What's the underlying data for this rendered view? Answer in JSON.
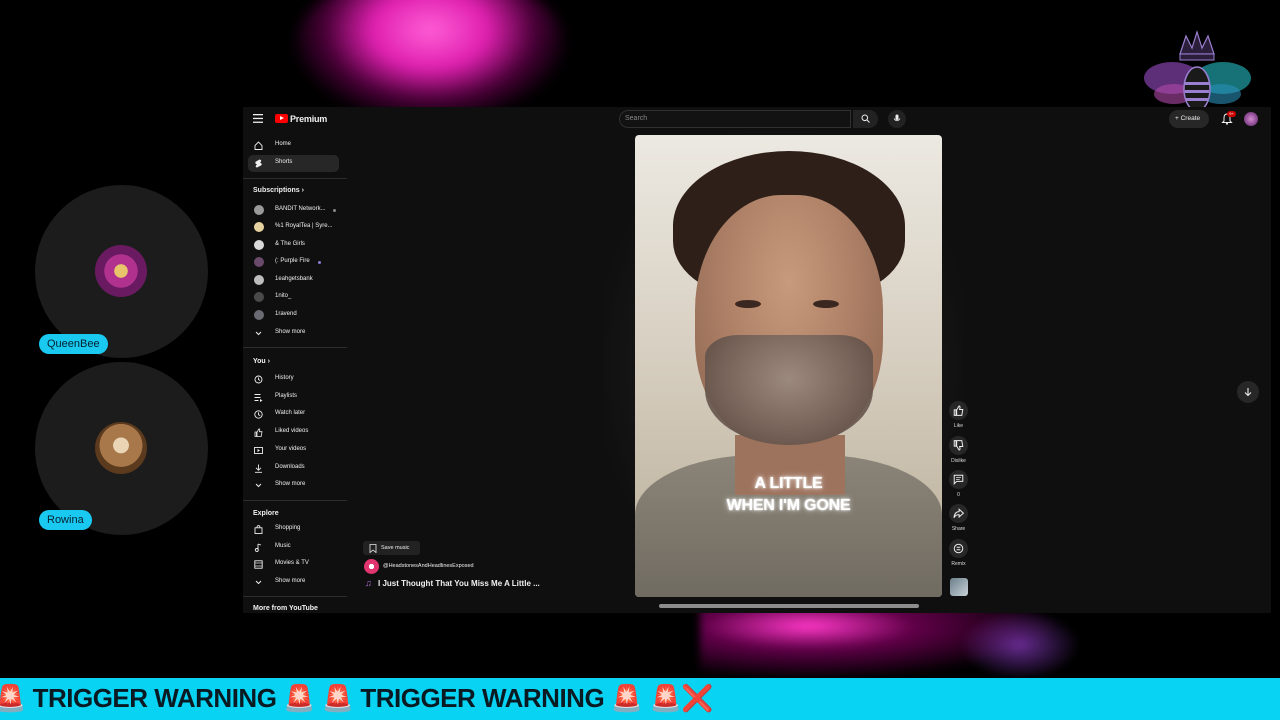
{
  "participants": [
    {
      "name": "QueenBee"
    },
    {
      "name": "Rowina"
    }
  ],
  "youtube": {
    "brand": "Premium",
    "search_placeholder": "Search",
    "create_label": "+ Create",
    "notification_count": "9+",
    "sidebar": {
      "main_items": [
        {
          "label": "Home",
          "icon": "home-icon"
        },
        {
          "label": "Shorts",
          "icon": "shorts-icon"
        }
      ],
      "subscriptions_heading": "Subscriptions",
      "subscriptions": [
        {
          "label": "BANDIT Network..."
        },
        {
          "label": "%1 RoyalTea | Syre..."
        },
        {
          "label": "& The Girls"
        },
        {
          "label": "(: Purple Fire"
        },
        {
          "label": "1eahgetsbank"
        },
        {
          "label": "1nito_"
        },
        {
          "label": "1ravend"
        }
      ],
      "subscriptions_more": "Show more",
      "you_heading": "You",
      "you_items": [
        {
          "label": "History",
          "icon": "history-icon"
        },
        {
          "label": "Playlists",
          "icon": "playlists-icon"
        },
        {
          "label": "Watch later",
          "icon": "clock-icon"
        },
        {
          "label": "Liked videos",
          "icon": "thumbs-up-icon"
        },
        {
          "label": "Your videos",
          "icon": "video-icon"
        },
        {
          "label": "Downloads",
          "icon": "download-icon"
        }
      ],
      "you_more": "Show more",
      "explore_heading": "Explore",
      "explore_items": [
        {
          "label": "Shopping",
          "icon": "shopping-bag-icon"
        },
        {
          "label": "Music",
          "icon": "music-note-icon"
        },
        {
          "label": "Movies & TV",
          "icon": "film-icon"
        }
      ],
      "explore_more": "Show more",
      "more_from": "More from YouTube"
    },
    "short": {
      "caption_line1": "A LITTLE",
      "caption_line2": "WHEN I'M GONE",
      "actions": [
        {
          "label": "Like",
          "icon": "thumbs-up-icon"
        },
        {
          "label": "Dislike",
          "icon": "thumbs-down-icon"
        },
        {
          "label": "0",
          "icon": "comment-icon"
        },
        {
          "label": "Share",
          "icon": "share-icon"
        },
        {
          "label": "Remix",
          "icon": "remix-icon"
        }
      ],
      "save_music_label": "Save music",
      "channel": "@HeadstonesAndHeadlinesExposed",
      "song_title": "I Just Thought That You Miss Me A Little ..."
    }
  },
  "ticker": {
    "text": "🚨 TRIGGER WARNING 🚨 🚨 TRIGGER WARNING 🚨  🚨❌"
  },
  "colors": {
    "ticker_bg": "#08d3f3",
    "participant_label_bg": "#19c9f0",
    "yt_red": "#ff0000",
    "yt_bg": "#0f0f0f"
  }
}
